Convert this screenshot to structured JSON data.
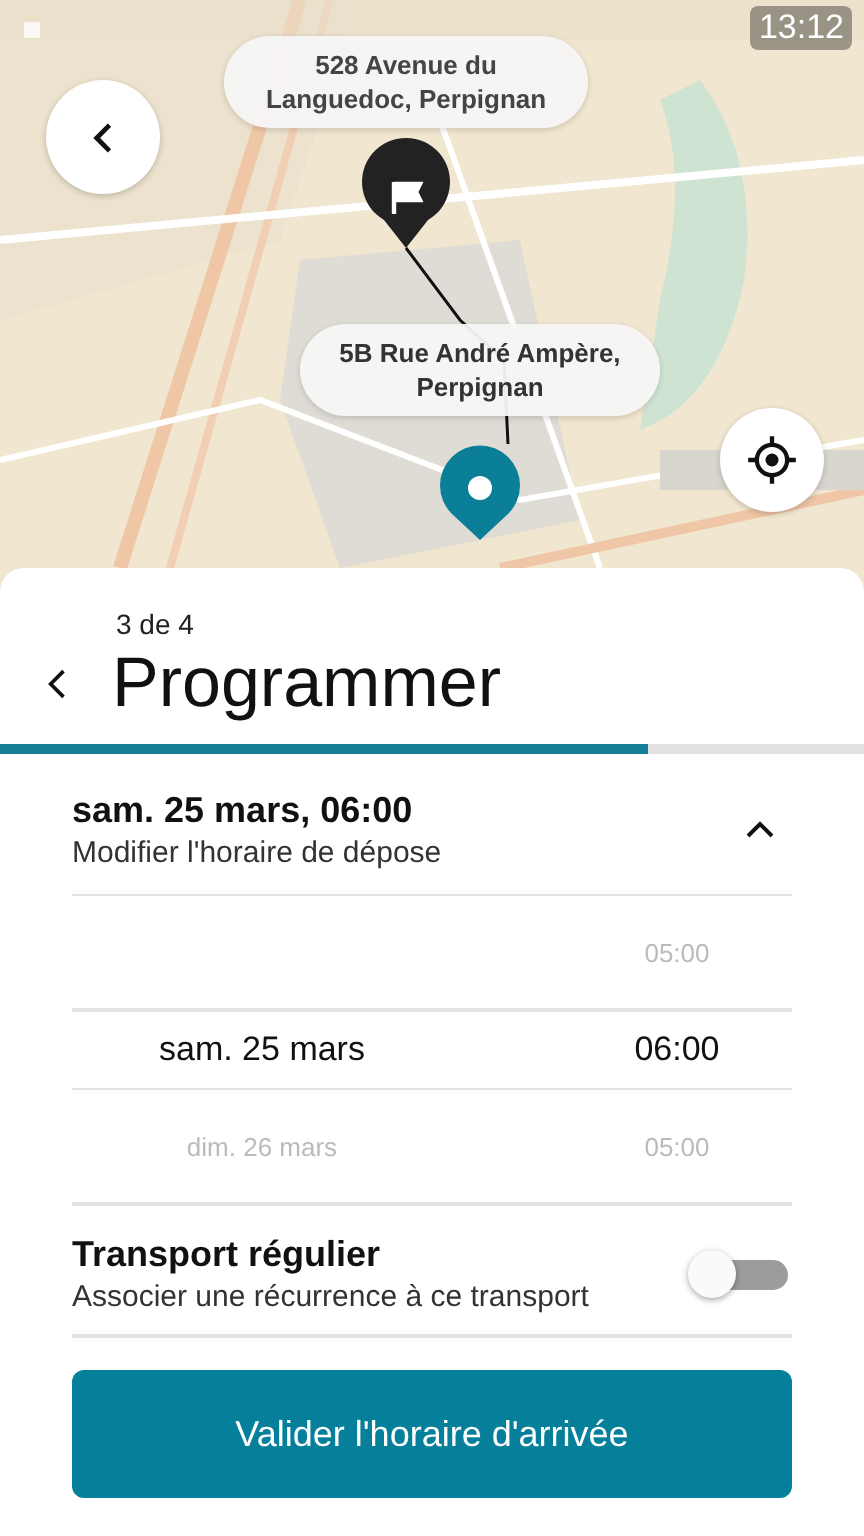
{
  "status_bar": {
    "time": "13:12"
  },
  "map": {
    "kind": "picture",
    "origin_label": "528 Avenue du Languedoc, Perpignan",
    "destination_label": "5B Rue André Ampère, Perpignan"
  },
  "step": {
    "counter": "3 de 4",
    "title": "Programmer",
    "level": 0.75
  },
  "schedule": {
    "title": "sam. 25 mars, 06:00",
    "subtitle": "Modifier l'horaire de dépose",
    "expanded": true,
    "rows": [
      {
        "date": "",
        "time": "05:00",
        "selected": false
      },
      {
        "date": "sam. 25 mars",
        "time": "06:00",
        "selected": true
      },
      {
        "date": "dim. 26 mars",
        "time": "05:00",
        "selected": false
      }
    ]
  },
  "recurring": {
    "title": "Transport régulier",
    "subtitle": "Associer une récurrence à ce transport",
    "on": false
  },
  "submit": {
    "label": "Valider l'horaire d'arrivée"
  }
}
